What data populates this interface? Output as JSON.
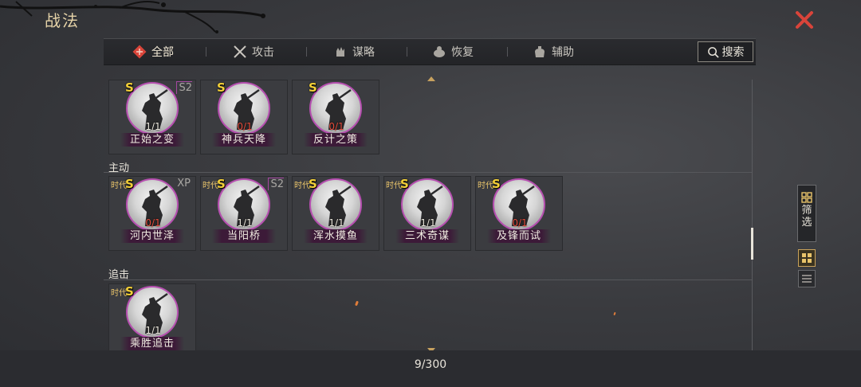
{
  "header": {
    "title": "战法"
  },
  "tabs": [
    {
      "label": "全部",
      "icon": "all-icon",
      "active": true
    },
    {
      "label": "攻击",
      "icon": "crossed-swords-icon",
      "active": false
    },
    {
      "label": "谋略",
      "icon": "strategy-hand-icon",
      "active": false
    },
    {
      "label": "恢复",
      "icon": "recover-icon",
      "active": false
    },
    {
      "label": "辅助",
      "icon": "assist-bag-icon",
      "active": false
    }
  ],
  "search": {
    "label": "搜索"
  },
  "sections": [
    {
      "title": "",
      "cards": [
        {
          "grade": "S",
          "tag": "S2",
          "era": "",
          "count": "1/1",
          "name": "正始之变",
          "owned": true
        },
        {
          "grade": "S",
          "tag": "",
          "era": "",
          "count": "0/1",
          "name": "神兵天降",
          "owned": false
        },
        {
          "grade": "S",
          "tag": "",
          "era": "",
          "count": "0/1",
          "name": "反计之策",
          "owned": false
        }
      ]
    },
    {
      "title": "主动",
      "cards": [
        {
          "grade": "S",
          "tag": "XP",
          "era": "时代",
          "count": "0/1",
          "name": "河内世泽",
          "owned": false
        },
        {
          "grade": "S",
          "tag": "S2",
          "era": "时代",
          "count": "1/1",
          "name": "当阳桥",
          "owned": true
        },
        {
          "grade": "S",
          "tag": "",
          "era": "时代",
          "count": "1/1",
          "name": "浑水摸鱼",
          "owned": true
        },
        {
          "grade": "S",
          "tag": "",
          "era": "时代",
          "count": "1/1",
          "name": "三术奇谋",
          "owned": true
        },
        {
          "grade": "S",
          "tag": "",
          "era": "时代",
          "count": "0/1",
          "name": "及锋而试",
          "owned": false
        }
      ]
    },
    {
      "title": "追击",
      "cards": [
        {
          "grade": "S",
          "tag": "",
          "era": "时代",
          "count": "1/1",
          "name": "乘胜追击",
          "owned": true
        }
      ]
    }
  ],
  "sidebar": {
    "filter_label": "筛选"
  },
  "footer": {
    "counter": "9/300"
  },
  "colors": {
    "accent_gold": "#e6d3a8",
    "grade_yellow": "#f4d038",
    "portrait_border": "#b64fb0",
    "zero_count": "#e24a3a",
    "close_red": "#d9443a"
  }
}
